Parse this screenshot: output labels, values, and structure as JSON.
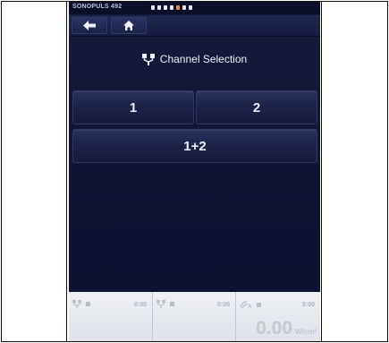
{
  "device": {
    "name": "SONOPULS 492"
  },
  "colors": {
    "screen_bg": "#0d1331",
    "accent": "#f28a2c",
    "panel_bg": "#e6e8ed"
  },
  "screen": {
    "title": "Channel Selection",
    "title_icon": "channel-fork-icon"
  },
  "buttons": {
    "channel1": "1",
    "channel2": "2",
    "channel_both": "1+2"
  },
  "nav": {
    "back_icon": "arrow-left-icon",
    "home_icon": "home-icon"
  },
  "status_panel": {
    "seg1": {
      "time": "0:00"
    },
    "seg2": {
      "time": "0:00"
    },
    "seg3": {
      "time": "5:00",
      "intensity": "0.00",
      "unit": "W/cm²"
    }
  }
}
